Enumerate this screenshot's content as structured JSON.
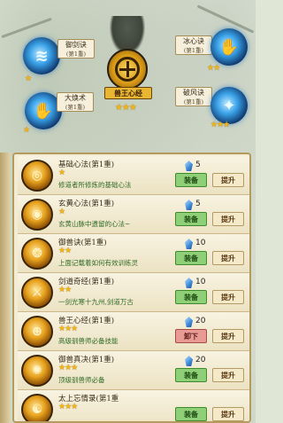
{
  "top": {
    "center": {
      "label": "兽王心经",
      "stars": "★★★"
    },
    "skills": [
      {
        "id": "yujianjue",
        "name": "御剑诀",
        "level": "(第1重)",
        "stars": "★",
        "glyph": "≋"
      },
      {
        "id": "bingxinjue",
        "name": "冰心诀",
        "level": "(第1重)",
        "stars": "★★",
        "glyph": "✋"
      },
      {
        "id": "dahuoshu",
        "name": "大焕术",
        "level": "(第1重)",
        "stars": "★",
        "glyph": "✋"
      },
      {
        "id": "pofengjue",
        "name": "破风诀",
        "level": "(第1重)",
        "stars": "★★★",
        "glyph": "✦"
      }
    ]
  },
  "list": {
    "equip_label": "装备",
    "unequip_label": "卸下",
    "upgrade_label": "提升",
    "rows": [
      {
        "name": "基础心法(第1重)",
        "stars": "★",
        "desc": "修道者所修炼的基础心法",
        "cost": "5",
        "action": "equip"
      },
      {
        "name": "玄黄心法(第1重)",
        "stars": "★",
        "desc": "玄黄山脉中遗留的心法~",
        "cost": "5",
        "action": "equip"
      },
      {
        "name": "御兽诀(第1重)",
        "stars": "★★",
        "desc": "上面记载着如何有效训练灵",
        "cost": "10",
        "action": "equip"
      },
      {
        "name": "剑道奇经(第1重)",
        "stars": "★★",
        "desc": "一剑光寒十九州,剑道万古",
        "cost": "10",
        "action": "equip"
      },
      {
        "name": "兽王心经(第1重)",
        "stars": "★★★",
        "desc": "高级驯兽师必备技能",
        "cost": "20",
        "action": "unequip"
      },
      {
        "name": "御兽真决(第1重)",
        "stars": "★★★",
        "desc": "顶级驯兽师必备",
        "cost": "20",
        "action": "equip"
      },
      {
        "name": "太上忘情录(第1重",
        "stars": "★★★",
        "desc": "",
        "cost": "",
        "action": "equip"
      }
    ]
  }
}
